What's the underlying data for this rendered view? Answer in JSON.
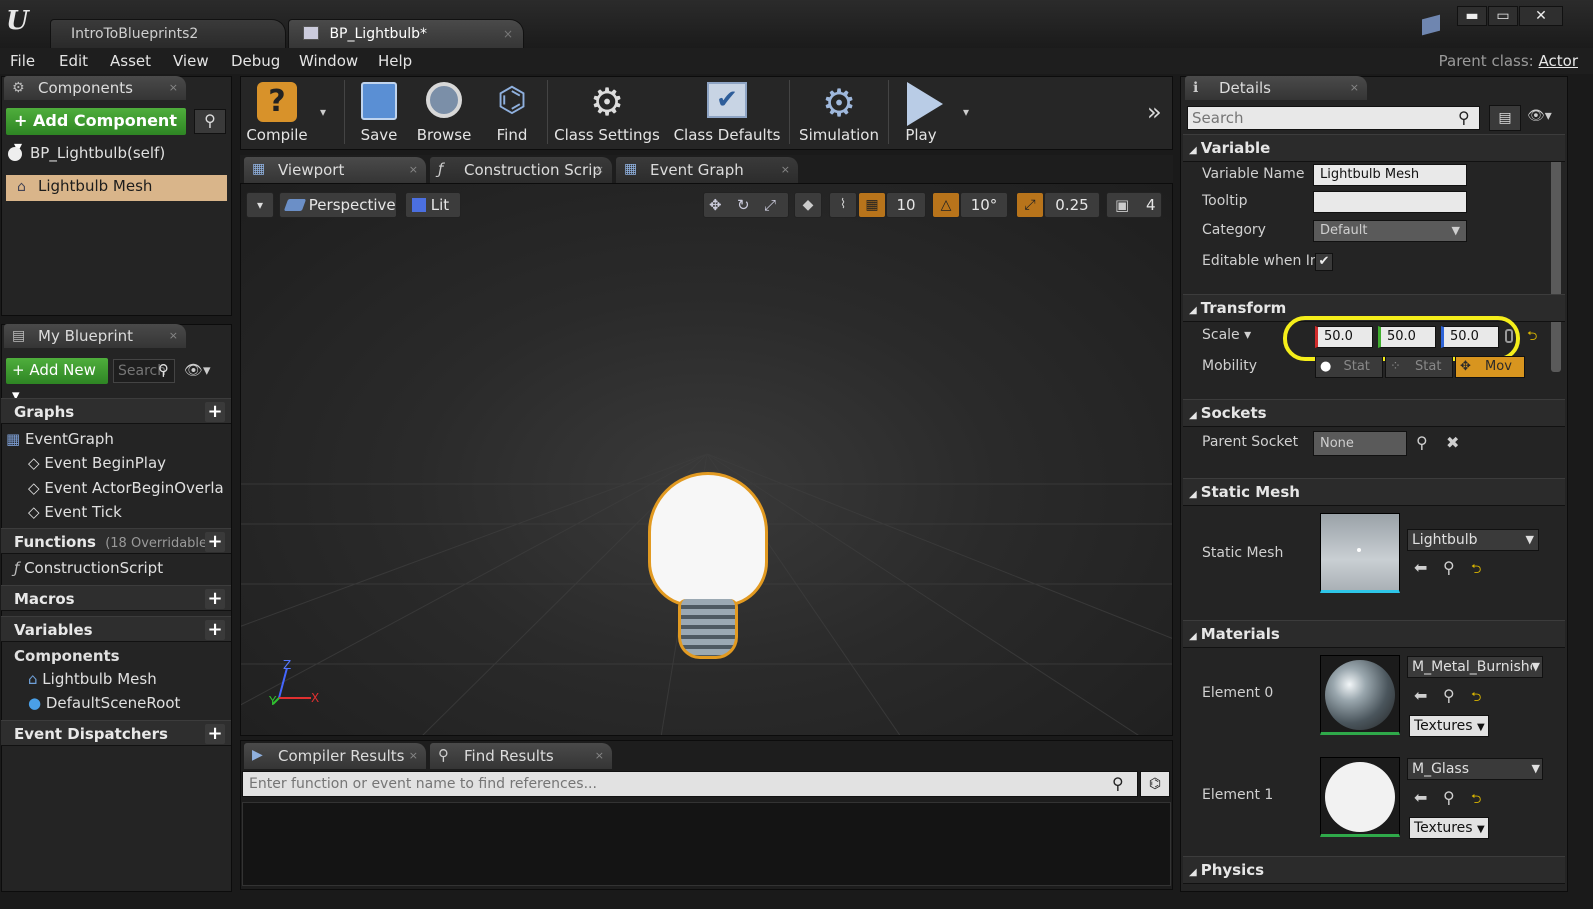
{
  "window": {
    "tabs": [
      {
        "label": "IntroToBlueprints2"
      },
      {
        "label": "BP_Lightbulb*"
      }
    ],
    "controls": {
      "minimize": "▬",
      "maximize": "▭",
      "close": "✕"
    }
  },
  "menu": [
    "File",
    "Edit",
    "Asset",
    "View",
    "Debug",
    "Window",
    "Help"
  ],
  "parent_class": {
    "label": "Parent class:",
    "value": "Actor"
  },
  "components_panel": {
    "tab": "Components",
    "add_button": "+ Add Component ▾",
    "items": [
      "BP_Lightbulb(self)",
      "Lightbulb Mesh"
    ]
  },
  "my_blueprint": {
    "tab": "My Blueprint",
    "add_new": "+ Add New ▾",
    "search_placeholder": "Search",
    "sections": {
      "graphs": "Graphs",
      "event_graph": "EventGraph",
      "events": [
        "Event BeginPlay",
        "Event ActorBeginOverla",
        "Event Tick"
      ],
      "functions": "Functions",
      "functions_note": "(18 Overridable)",
      "construction_script": "ConstructionScript",
      "macros": "Macros",
      "variables": "Variables",
      "components": "Components",
      "component_vars": [
        "Lightbulb Mesh",
        "DefaultSceneRoot"
      ],
      "event_dispatchers": "Event Dispatchers"
    }
  },
  "toolbar": {
    "compile": "Compile",
    "save": "Save",
    "browse": "Browse",
    "find": "Find",
    "class_settings": "Class Settings",
    "class_defaults": "Class Defaults",
    "simulation": "Simulation",
    "play": "Play"
  },
  "editor_tabs": [
    "Viewport",
    "Construction Scrip",
    "Event Graph"
  ],
  "viewport": {
    "perspective": "Perspective",
    "lit": "Lit",
    "grid_snap": "10",
    "rot_snap": "10°",
    "scale_snap": "0.25",
    "camera_speed": "4",
    "axis": {
      "z": "Z",
      "y": "Y",
      "x": "X"
    }
  },
  "bottom": {
    "tabs": [
      "Compiler Results",
      "Find Results"
    ],
    "find_placeholder": "Enter function or event name to find references..."
  },
  "details": {
    "tab": "Details",
    "search_placeholder": "Search",
    "variable": {
      "header": "Variable",
      "name_label": "Variable Name",
      "name_value": "Lightbulb Mesh",
      "tooltip_label": "Tooltip",
      "category_label": "Category",
      "category_value": "Default",
      "editable_label": "Editable when Inl"
    },
    "transform": {
      "header": "Transform",
      "scale_label": "Scale ▾",
      "scale": [
        "50.0",
        "50.0",
        "50.0"
      ],
      "mobility_label": "Mobility",
      "mobility": [
        "Stat",
        "Stat",
        "Mov"
      ]
    },
    "sockets": {
      "header": "Sockets",
      "parent_label": "Parent Socket",
      "parent_value": "None"
    },
    "static_mesh": {
      "header": "Static Mesh",
      "label": "Static Mesh",
      "value": "Lightbulb"
    },
    "materials": {
      "header": "Materials",
      "elements": [
        {
          "label": "Element 0",
          "value": "M_Metal_Burnishe",
          "textures": "Textures"
        },
        {
          "label": "Element 1",
          "value": "M_Glass",
          "textures": "Textures"
        }
      ]
    },
    "physics": {
      "header": "Physics"
    }
  },
  "colors": {
    "highlight_ring": "#f5ee1a",
    "accent_orange": "#b8741b",
    "green": "#3a9a2c"
  }
}
